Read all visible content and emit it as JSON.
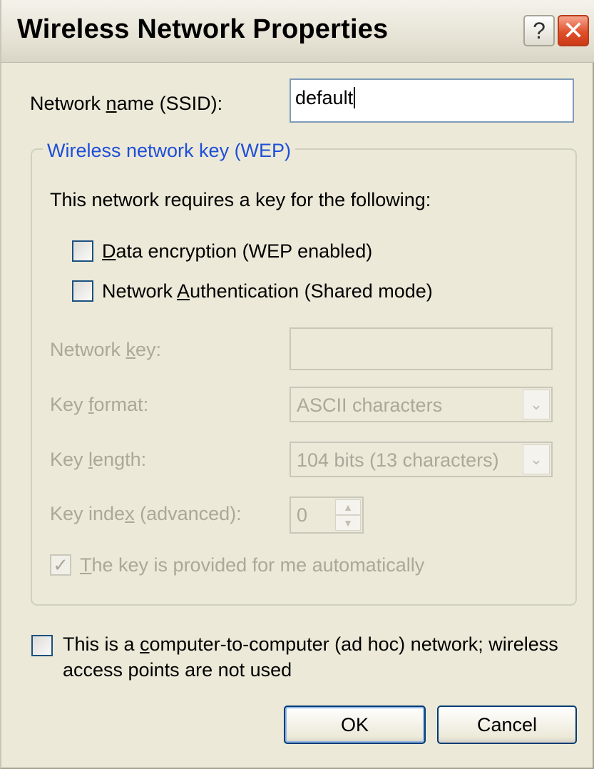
{
  "window": {
    "title": "Wireless Network Properties",
    "help_glyph": "?",
    "close_glyph": "✕"
  },
  "ssid": {
    "label_pre": "Network ",
    "label_u": "n",
    "label_post": "ame (SSID):",
    "value": "default"
  },
  "wep_group": {
    "legend": "Wireless network key (WEP)",
    "intro": "This network requires a key for the following:",
    "data_encryption": {
      "u": "D",
      "rest": "ata encryption (WEP enabled)",
      "checked": false
    },
    "network_auth": {
      "pre": "Network ",
      "u": "A",
      "rest": "uthentication (Shared mode)",
      "checked": false
    },
    "network_key": {
      "pre": "Network ",
      "u": "k",
      "post": "ey:",
      "value": ""
    },
    "key_format": {
      "pre": "Key ",
      "u": "f",
      "post": "ormat:",
      "value": "ASCII characters"
    },
    "key_length": {
      "pre": "Key ",
      "u": "l",
      "post": "ength:",
      "value": "104 bits (13 characters)"
    },
    "key_index": {
      "pre": "Key inde",
      "u": "x",
      "post": " (advanced):",
      "value": "0"
    },
    "auto_key": {
      "u": "T",
      "rest": "he key is provided for me automatically",
      "checked": true,
      "check_glyph": "✓"
    }
  },
  "adhoc": {
    "line1_pre": "This is a ",
    "line1_u": "c",
    "line1_post": "omputer-to-computer (ad hoc) network; wireless",
    "line2": "access points are not used",
    "checked": false
  },
  "buttons": {
    "ok": "OK",
    "cancel": "Cancel"
  },
  "icons": {
    "dropdown": "chevron-down-icon",
    "spin_up": "triangle-up-icon",
    "spin_down": "triangle-down-icon"
  },
  "colors": {
    "legend": "#1f4fd8",
    "disabled_text": "#aca899",
    "close_button": "#e0502b",
    "face": "#ece9d8"
  }
}
